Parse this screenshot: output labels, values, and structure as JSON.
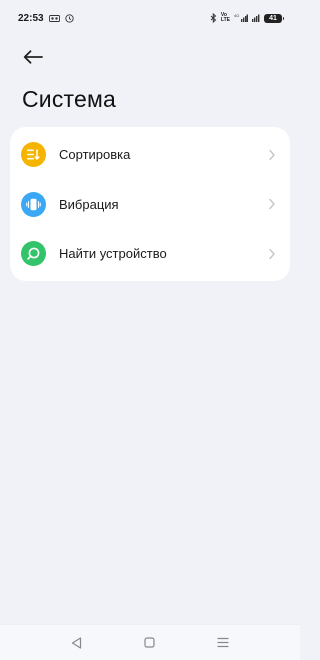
{
  "status_bar": {
    "time": "22:53",
    "volte_line1": "Vo",
    "volte_line2": "LTE",
    "battery_level": "41"
  },
  "header": {
    "title": "Система"
  },
  "settings": {
    "items": [
      {
        "label": "Сортировка",
        "icon": "sort-icon",
        "color": "#f5b400"
      },
      {
        "label": "Вибрация",
        "icon": "vibration-icon",
        "color": "#3aa8f4"
      },
      {
        "label": "Найти устройство",
        "icon": "find-device-icon",
        "color": "#33c46b"
      }
    ]
  },
  "navigation": {
    "buttons": [
      "back-triangle-icon",
      "home-square-icon",
      "recents-menu-icon"
    ]
  }
}
